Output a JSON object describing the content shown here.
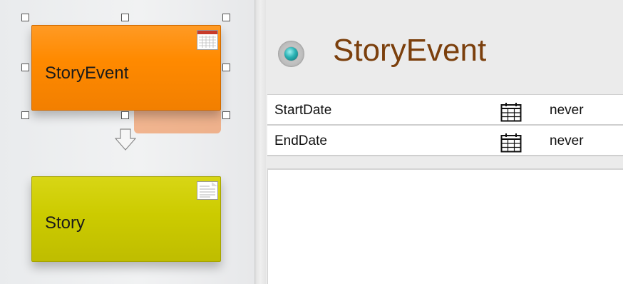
{
  "diagram": {
    "nodes": [
      {
        "label": "StoryEvent",
        "color": "#ff8a00",
        "icon": "calendar-icon",
        "selected": true
      },
      {
        "label": "Story",
        "color": "#cccb00",
        "icon": "document-icon",
        "selected": false
      }
    ],
    "connector": "down-arrow-icon"
  },
  "panel": {
    "status_icon": "status-dot-icon",
    "title": "StoryEvent",
    "title_color": "#7b3f0c",
    "attributes": [
      {
        "name": "StartDate",
        "type_icon": "calendar-icon",
        "value": "never"
      },
      {
        "name": "EndDate",
        "type_icon": "calendar-icon",
        "value": "never"
      }
    ]
  }
}
